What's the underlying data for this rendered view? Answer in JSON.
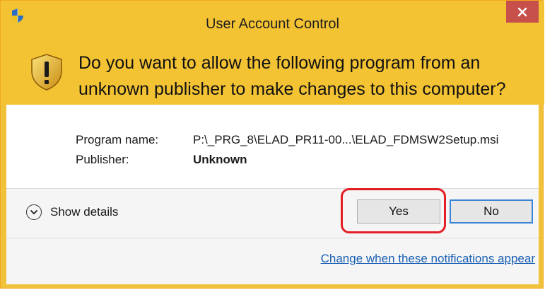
{
  "window": {
    "title": "User Account Control",
    "close_label": "×"
  },
  "banner": {
    "question_line1": "Do you want to allow the following program from an",
    "question_line2": "unknown publisher to make changes to this computer?"
  },
  "info": {
    "program_label": "Program name:",
    "program_value": "P:\\_PRG_8\\ELAD_PR11-00...\\ELAD_FDMSW2Setup.msi",
    "publisher_label": "Publisher:",
    "publisher_value": "Unknown"
  },
  "actions": {
    "details_label": "Show details",
    "yes_label": "Yes",
    "no_label": "No",
    "notifications_link": "Change when these notifications appear"
  },
  "icons": {
    "title": "uac-shield-icon",
    "banner": "warning-shield-icon",
    "details": "chevron-down-icon",
    "close": "close-icon"
  },
  "colors": {
    "banner": "#f4c334",
    "close": "#c7504b",
    "highlight": "#e31e24",
    "link": "#1a5fb4"
  }
}
